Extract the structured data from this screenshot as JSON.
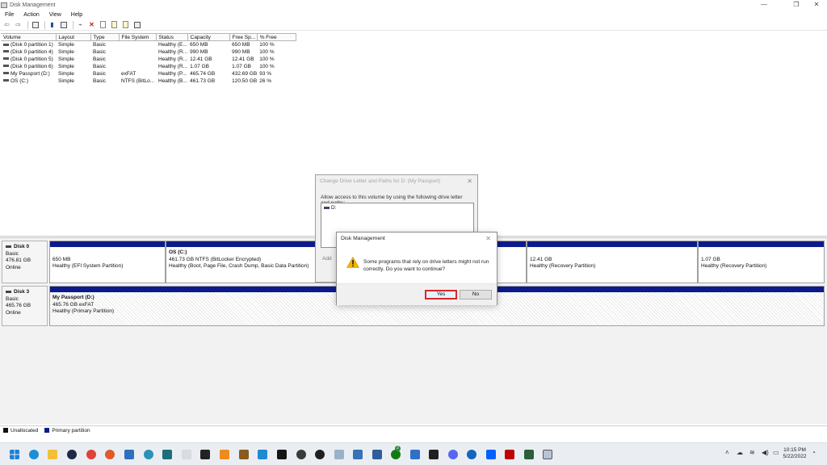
{
  "window": {
    "title": "Disk Management"
  },
  "menu": [
    "File",
    "Action",
    "View",
    "Help"
  ],
  "toolbar_icons": [
    "back-icon",
    "forward-icon",
    "list-view-icon",
    "help-book-icon",
    "properties-icon",
    "connect-icon",
    "delete-icon",
    "refresh-icon",
    "new-icon",
    "open-icon",
    "settings-icon"
  ],
  "volume_table": {
    "columns": [
      "Volume",
      "Layout",
      "Type",
      "File System",
      "Status",
      "Capacity",
      "Free Sp...",
      "% Free"
    ],
    "rows": [
      [
        "(Disk 0 partition 1)",
        "Simple",
        "Basic",
        "",
        "Healthy (E...",
        "650 MB",
        "650 MB",
        "100 %"
      ],
      [
        "(Disk 0 partition 4)",
        "Simple",
        "Basic",
        "",
        "Healthy (R...",
        "990 MB",
        "990 MB",
        "100 %"
      ],
      [
        "(Disk 0 partition 5)",
        "Simple",
        "Basic",
        "",
        "Healthy (R...",
        "12.41 GB",
        "12.41 GB",
        "100 %"
      ],
      [
        "(Disk 0 partition 6)",
        "Simple",
        "Basic",
        "",
        "Healthy (R...",
        "1.07 GB",
        "1.07 GB",
        "100 %"
      ],
      [
        "My Passport (D:)",
        "Simple",
        "Basic",
        "exFAT",
        "Healthy (P...",
        "465.74 GB",
        "432.69 GB",
        "93 %"
      ],
      [
        "OS (C:)",
        "Simple",
        "Basic",
        "NTFS (BitLo...",
        "Healthy (B...",
        "461.73 GB",
        "120.50 GB",
        "26 %"
      ]
    ]
  },
  "disks": [
    {
      "name": "Disk 0",
      "type": "Basic",
      "size": "476.81 GB",
      "state": "Online",
      "partitions": [
        {
          "name": "",
          "size": "650 MB",
          "status": "Healthy (EFI System Partition)"
        },
        {
          "name": "OS  (C:)",
          "size": "461.73 GB NTFS (BitLocker Encrypted)",
          "status": "Healthy (Boot, Page File, Crash Dump, Basic Data Partition)"
        },
        {
          "name": "",
          "size": "12.41 GB",
          "status": "Healthy (Recovery Partition)"
        },
        {
          "name": "",
          "size": "1.07 GB",
          "status": "Healthy (Recovery Partition)"
        }
      ]
    },
    {
      "name": "Disk 3",
      "type": "Basic",
      "size": "465.76 GB",
      "state": "Online",
      "partitions": [
        {
          "name": "My Passport  (D:)",
          "size": "465.76 GB exFAT",
          "status": "Healthy (Primary Partition)"
        }
      ]
    }
  ],
  "legend": [
    {
      "label": "Unallocated",
      "color": "#111111"
    },
    {
      "label": "Primary partition",
      "color": "#0c1a8c"
    }
  ],
  "bg_dialog": {
    "title": "Change Drive Letter and Paths for D: (My Passport)",
    "prompt": "Allow access to this volume by using the following drive letter and paths:",
    "list_item": "D:",
    "add_label": "Add"
  },
  "dialog": {
    "title": "Disk Management",
    "message": "Some programs that rely on drive letters might not run correctly. Do you want to continue?",
    "yes": "Yes",
    "no": "No"
  },
  "taskbar": {
    "apps": [
      "windows-start-icon",
      "edge-icon",
      "file-explorer-icon",
      "steam-icon",
      "chrome-icon",
      "headphones-app-icon",
      "mail-icon",
      "globe-app-icon",
      "teams-app-icon",
      "notepad-icon",
      "terminal-icon",
      "vlc-icon",
      "vscode-icon",
      "netflix-icon",
      "media-icon",
      "steam-alt-icon",
      "control-panel-icon",
      "xbox-icon",
      "store-icon",
      "discord-icon",
      "onedrive-icon",
      "dropbox-icon",
      "filezilla-icon",
      "app-icon",
      "disk-management-icon"
    ],
    "badge": "2",
    "time": "10:15 PM",
    "date": "5/22/2022"
  },
  "colors": {
    "primary_partition": "#0c1a8c",
    "highlight": "#d9262c"
  }
}
